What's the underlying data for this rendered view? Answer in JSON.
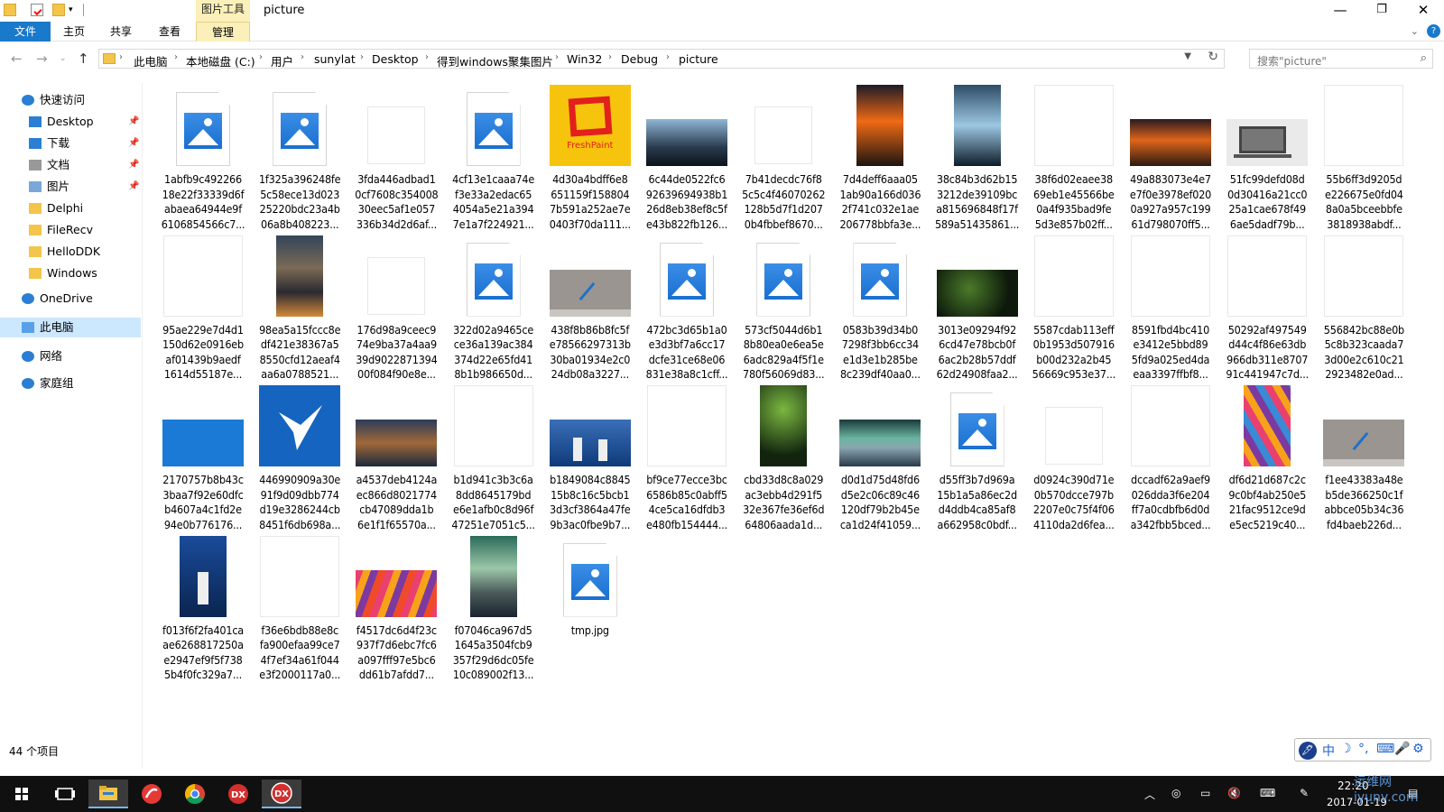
{
  "window": {
    "title": "picture",
    "tool_tab": "图片工具",
    "controls": {
      "minimize": "—",
      "maximize": "❐",
      "close": "✕"
    }
  },
  "ribbon": {
    "tabs": [
      "文件",
      "主页",
      "共享",
      "查看",
      "管理"
    ],
    "expand_icon": "chevron-down-icon",
    "help_label": "?"
  },
  "address": {
    "crumbs": [
      "此电脑",
      "本地磁盘 (C:)",
      "用户",
      "sunylat",
      "Desktop",
      "得到windows聚集图片",
      "Win32",
      "Debug",
      "picture"
    ]
  },
  "search": {
    "placeholder": "搜索\"picture\""
  },
  "sidebar": {
    "items": [
      {
        "label": "快速访问",
        "icon": "star-icon"
      },
      {
        "label": "Desktop",
        "icon": "desktop-icon",
        "pinned": true
      },
      {
        "label": "下载",
        "icon": "download-icon",
        "pinned": true
      },
      {
        "label": "文档",
        "icon": "document-icon",
        "pinned": true
      },
      {
        "label": "图片",
        "icon": "pictures-icon",
        "pinned": true
      },
      {
        "label": "Delphi",
        "icon": "folder-icon"
      },
      {
        "label": "FileRecv",
        "icon": "folder-icon"
      },
      {
        "label": "HelloDDK",
        "icon": "folder-icon"
      },
      {
        "label": "Windows",
        "icon": "folder-icon"
      },
      {
        "label": "OneDrive",
        "icon": "cloud-icon"
      },
      {
        "label": "此电脑",
        "icon": "computer-icon",
        "selected": true
      },
      {
        "label": "网络",
        "icon": "network-icon"
      },
      {
        "label": "家庭组",
        "icon": "homegroup-icon"
      }
    ]
  },
  "files": [
    {
      "name": "1abfb9c492266\n18e22f33339d6f\nabaea64944e9f\n6106854566c7...",
      "kind": "icon"
    },
    {
      "name": "1f325a396248fe\n5c58ece13d023\n25220bdc23a4b\n06a8b408223...",
      "kind": "icon"
    },
    {
      "name": "3fda446adbad1\n0cf7608c354008\n30eec5af1e057\n336b34d2d6af...",
      "kind": "blank"
    },
    {
      "name": "4cf13e1caaa74e\nf3e33a2edac65\n4054a5e21a394\n7e1a7f224921...",
      "kind": "icon"
    },
    {
      "name": "4d30a4bdff6e8\n651159f158804\n7b591a252ae7e\n0403f70da111...",
      "kind": "freshpaint",
      "caption": "FreshPaint"
    },
    {
      "name": "6c44de0522fc6\n92639694938b1\n26d8eb38ef8c5f\ne43b822fb126...",
      "kind": "ice"
    },
    {
      "name": "7b41decdc76f8\n5c5c4f46070262\n128b5d7f1d207\n0b4fbbef8670...",
      "kind": "blank"
    },
    {
      "name": "7d4deff6aaa05\n1ab90a166d036\n2f741c032e1ae\n206778bbfa3e...",
      "kind": "sunset-tall"
    },
    {
      "name": "38c84b3d62b15\n3212de39109bc\na815696848f17f\n589a51435861...",
      "kind": "ice-tall"
    },
    {
      "name": "38f6d02eaee38\n69eb1e45566be\n0a4f935bad9fe\n5d3e857b02ff...",
      "kind": "blank-tall"
    },
    {
      "name": "49a883073e4e7\ne7f0e3978ef020\n0a927a957c199\n61d798070ff5...",
      "kind": "sunset"
    },
    {
      "name": "51fc99defd08d\n0d30416a21cc0\n25a1cae678f49\n6ae5dadf79b...",
      "kind": "laptop"
    },
    {
      "name": "55b6ff3d9205d\ne226675e0fd04\n8a0a5bceebbfe\n3818938abdf...",
      "kind": "blank-tall"
    },
    {
      "name": "95ae229e7d4d1\n150d62e0916eb\naf01439b9aedf\n1614d55187e...",
      "kind": "blank-tall"
    },
    {
      "name": "98ea5a15fccc8e\ndf421e38367a5\n8550cfd12aeaf4\naa6a0788521...",
      "kind": "city-tall"
    },
    {
      "name": "176d98a9ceec9\n74e9ba37a4aa9\n39d9022871394\n00f084f90e8e...",
      "kind": "blank"
    },
    {
      "name": "322d02a9465ce\nce36a139ac384\n374d22e65fd41\n8b1b986650d...",
      "kind": "icon"
    },
    {
      "name": "438f8b86b8fc5f\ne78566297313b\n30ba01934e2c0\n24db08a3227...",
      "kind": "surface"
    },
    {
      "name": "472bc3d65b1a0\ne3d3bf7a6cc17\ndcfe31ce68e06\n831e38a8c1cff...",
      "kind": "icon"
    },
    {
      "name": "573cf5044d6b1\n8b80ea0e6ea5e\n6adc829a4f5f1e\n780f56069d83...",
      "kind": "icon"
    },
    {
      "name": "0583b39d34b0\n7298f3bb6cc34\ne1d3e1b285be\n8c239df40aa0...",
      "kind": "icon"
    },
    {
      "name": "3013e09294f92\n6cd47e78bcb0f\n6ac2b28b57ddf\n62d24908faa2...",
      "kind": "forest"
    },
    {
      "name": "5587cdab113eff\n0b1953d507916\nb00d232a2b45\n56669c953e37...",
      "kind": "blank-tall"
    },
    {
      "name": "8591fbd4bc410\ne3412e5bbd89\n5fd9a025ed4da\neaa3397ffbf8...",
      "kind": "blank-tall"
    },
    {
      "name": "50292af497549\nd44c4f86e63db\n966db311e8707\n91c441947c7d...",
      "kind": "blank-tall"
    },
    {
      "name": "556842bc88e0b\n5c8b323caada7\n3d00e2c610c21\n2923482e0ad...",
      "kind": "blank-tall"
    },
    {
      "name": "2170757b8b43c\n3baa7f92e60dfc\nb4607a4c1fd2e\n94e0b776176...",
      "kind": "blue"
    },
    {
      "name": "446990909a30e\n91f9d09dbb774\nd19e3286244cb\n8451f6db698a...",
      "kind": "bird"
    },
    {
      "name": "a4537deb4124a\nec866d8021774\ncb47089dda1b\n6e1f1f65570a...",
      "kind": "harbor"
    },
    {
      "name": "b1d941c3b3c6a\n8dd8645179bd\ne6e1afb0c8d96f\n47251e7051c5...",
      "kind": "blank-tall"
    },
    {
      "name": "b1849084c8845\n15b8c16c5bcb1\n3d3cf3864a47fe\n9b3ac0fbe9b7...",
      "kind": "windmill"
    },
    {
      "name": "bf9ce77ecce3bc\n6586b85c0abff5\n4ce5ca16dfdb3\ne480fb154444...",
      "kind": "blank-tall"
    },
    {
      "name": "cbd33d8c8a029\nac3ebb4d291f5\n32e367fe36ef6d\n64806aada1d...",
      "kind": "forest-tall"
    },
    {
      "name": "d0d1d75d48fd6\nd5e2c06c89c46\n120df79b2b45e\nca1d24f41059...",
      "kind": "aurora"
    },
    {
      "name": "d55ff3b7d969a\n15b1a5a86ec2d\nd4ddb4ca85af8\na662958c0bdf...",
      "kind": "icon"
    },
    {
      "name": "d0924c390d71e\n0b570dcce797b\n2207e0c75f4f06\n4110da2d6fea...",
      "kind": "blank"
    },
    {
      "name": "dccadf62a9aef9\n026dda3f6e204\nff7a0cdbfb6d0d\na342fbb5bced...",
      "kind": "blank-tall"
    },
    {
      "name": "df6d21d687c2c\n9c0bf4ab250e5\n21fac9512ce9d\ne5ec5219c40...",
      "kind": "stripes-tall"
    },
    {
      "name": "f1ee43383a48e\nb5de366250c1f\nabbce05b34c36\nfd4baeb226d...",
      "kind": "surface"
    },
    {
      "name": "f013f6f2fa401ca\nae6268817250a\ne2947ef9f5f738\n5b4f0fc329a7...",
      "kind": "windmill-tall"
    },
    {
      "name": "f36e6bdb88e8c\nfa900efaa99ce7\n4f7ef34a61f044\ne3f2000117a0...",
      "kind": "blank-tall"
    },
    {
      "name": "f4517dc6d4f23c\n937f7d6ebc7fc6\na097fff97e5bc6\ndd61b7afdd7...",
      "kind": "stripes"
    },
    {
      "name": "f07046ca967d5\n1645a3504fcb9\n357f29d6dc05fe\n10c089002f13...",
      "kind": "aurora-tall"
    },
    {
      "name": "tmp.jpg",
      "kind": "icon"
    }
  ],
  "status": {
    "count": "44 个项目"
  },
  "ime": {
    "glyphs": [
      "中",
      "☽",
      "°,",
      "⌨",
      "🎤",
      "⚙"
    ]
  },
  "taskbar": {
    "apps": [
      "start-button",
      "task-view-button",
      "file-explorer-app",
      "red-app",
      "chrome-app",
      "dx-app",
      "dx-app-2"
    ],
    "clock_time": "22:20",
    "clock_date": "2017-01-19"
  },
  "watermark": "运维网\niyunv.com",
  "colors": {
    "accent": "#1979ca",
    "tool_tab": "#fbf0b9",
    "selected": "#cce8ff",
    "taskbar": "#101010"
  }
}
